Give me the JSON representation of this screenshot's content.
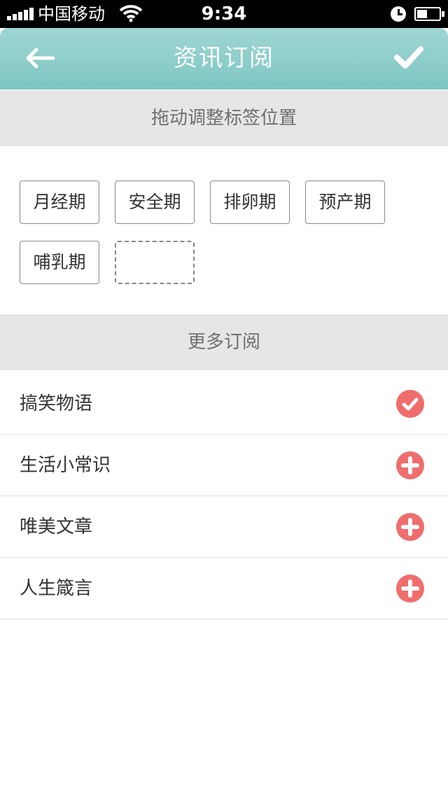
{
  "status_bar": {
    "carrier": "中国移动",
    "time": "9:34"
  },
  "header": {
    "title": "资讯订阅",
    "back_icon": "arrow-left-icon",
    "confirm_icon": "check-icon"
  },
  "sections": {
    "drag_hint": "拖动调整标签位置",
    "more": "更多订阅"
  },
  "tags": [
    "月经期",
    "安全期",
    "排卵期",
    "预产期",
    "哺乳期"
  ],
  "subscriptions": [
    {
      "label": "搞笑物语",
      "state": "subscribed",
      "icon": "checkmark-circle-icon"
    },
    {
      "label": "生活小常识",
      "state": "add",
      "icon": "plus-circle-icon"
    },
    {
      "label": "唯美文章",
      "state": "add",
      "icon": "plus-circle-icon"
    },
    {
      "label": "人生箴言",
      "state": "add",
      "icon": "plus-circle-icon"
    }
  ],
  "colors": {
    "header": "#7ec6c3",
    "accent": "#f06d6d",
    "section_bg": "#e6e6e6"
  }
}
